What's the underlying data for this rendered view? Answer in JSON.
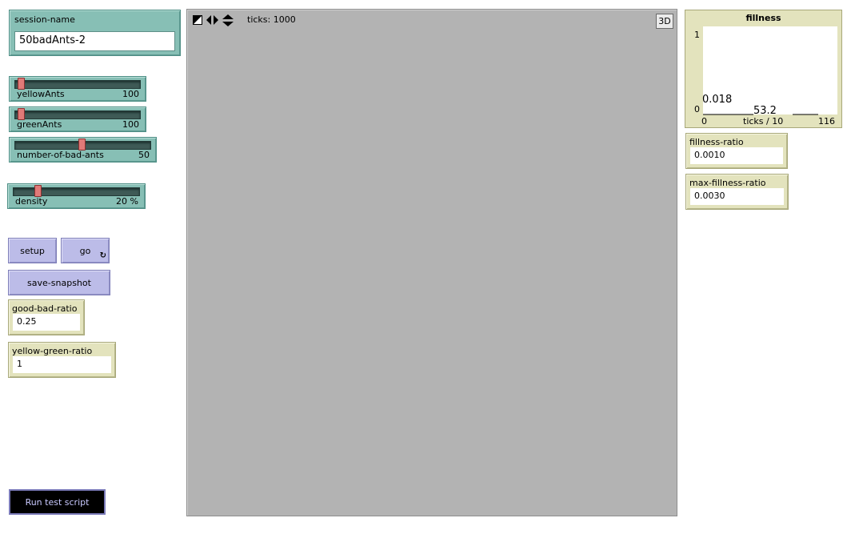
{
  "session": {
    "label": "session-name",
    "value": "50badAnts-2"
  },
  "sliders": {
    "yellowAnts": {
      "label": "yellowAnts",
      "value": "100",
      "fraction": 0.0
    },
    "greenAnts": {
      "label": "greenAnts",
      "value": "100",
      "fraction": 0.0
    },
    "bad": {
      "label": "number-of-bad-ants",
      "value": "50",
      "fraction": 0.5
    },
    "density": {
      "label": "density",
      "value": "20 %",
      "fraction": 0.2
    }
  },
  "buttons": {
    "setup": "setup",
    "go": "go",
    "save": "save-snapshot",
    "run": "Run test script"
  },
  "monitors": {
    "good_bad": {
      "label": "good-bad-ratio",
      "value": "0.25"
    },
    "yellow_green": {
      "label": "yellow-green-ratio",
      "value": "1"
    },
    "fillness_ratio": {
      "label": "fillness-ratio",
      "value": "0.0010"
    },
    "max_fillness": {
      "label": "max-fillness-ratio",
      "value": "0.0030"
    }
  },
  "view": {
    "ticks": "ticks: 1000",
    "three_d": "3D"
  },
  "plot": {
    "title": "fillness",
    "ymax": "1",
    "ymin": "0",
    "xmin": "0",
    "xmax": "116",
    "xlabel": "ticks / 10",
    "annotation_y": "0.018",
    "annotation_x": "53.2"
  },
  "colors": {
    "slider": "#87bfb5",
    "button": "#bcbce8",
    "monitor": "#e3e3bd",
    "world": "#b3b3b3"
  },
  "chart_data": {
    "type": "line",
    "title": "fillness",
    "xlabel": "ticks / 10",
    "ylabel": "",
    "xlim": [
      0,
      116
    ],
    "ylim": [
      0,
      1
    ],
    "series": []
  }
}
